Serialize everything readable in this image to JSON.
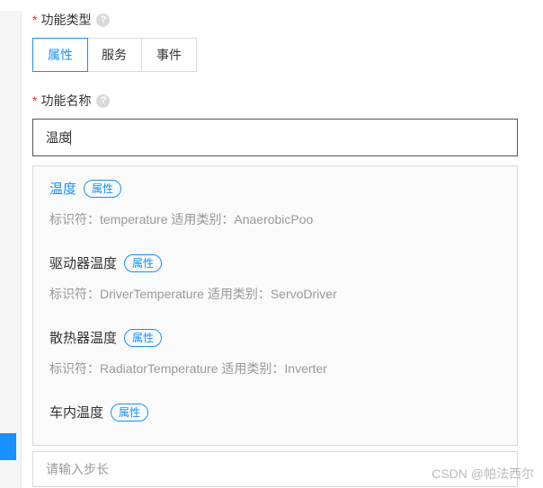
{
  "labels": {
    "function_type": "功能类型",
    "function_name": "功能名称",
    "required_mark": "*",
    "help_glyph": "?"
  },
  "tabs": {
    "items": [
      {
        "label": "属性",
        "active": true
      },
      {
        "label": "服务",
        "active": false
      },
      {
        "label": "事件",
        "active": false
      }
    ]
  },
  "name_input": {
    "value": "温度"
  },
  "badge_text": "属性",
  "detail_labels": {
    "identifier": "标识符：",
    "category": " 适用类别："
  },
  "dropdown": {
    "options": [
      {
        "name": "温度",
        "identifier": "temperature",
        "category": "AnaerobicPoo",
        "selected": true
      },
      {
        "name": "驱动器温度",
        "identifier": "DriverTemperature",
        "category": "ServoDriver",
        "selected": false
      },
      {
        "name": "散热器温度",
        "identifier": "RadiatorTemperature",
        "category": "Inverter",
        "selected": false
      },
      {
        "name": "车内温度",
        "identifier": "",
        "category": "",
        "selected": false
      }
    ]
  },
  "step_input": {
    "placeholder": "请输入步长"
  },
  "watermark": "CSDN @帕法西尔"
}
